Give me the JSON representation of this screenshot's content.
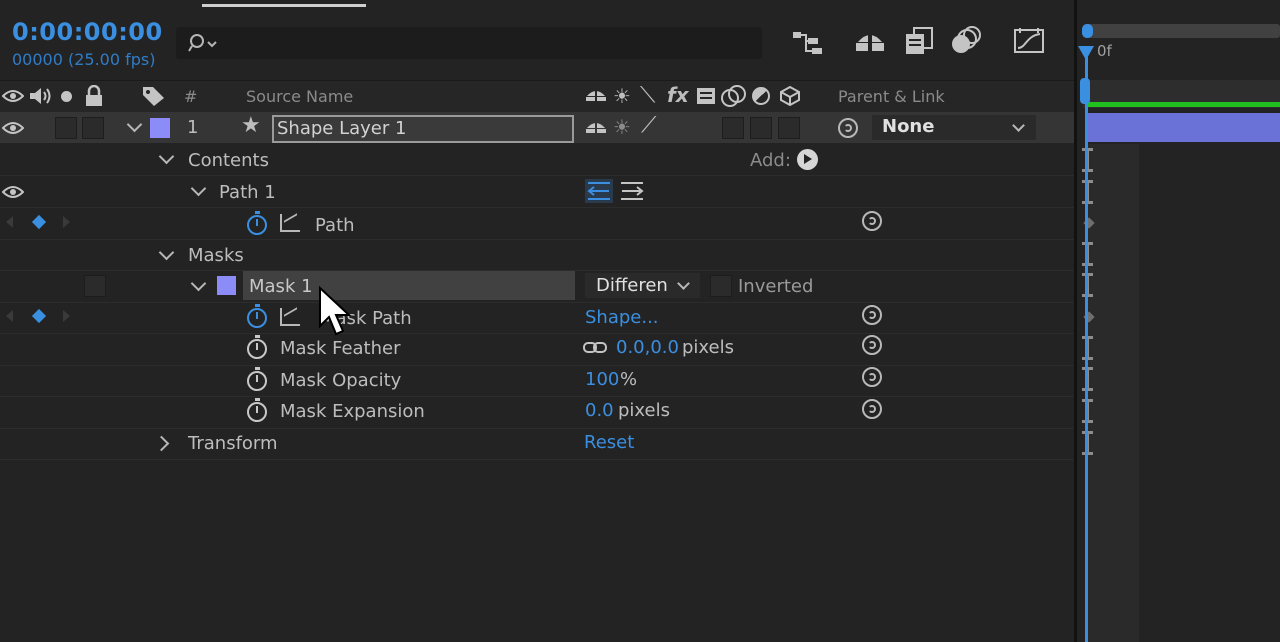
{
  "timecode": {
    "current": "0:00:00:00",
    "frames": "00000 (25.00 fps)"
  },
  "search": {
    "placeholder": ""
  },
  "time_ruler": {
    "label": "0f"
  },
  "columns": {
    "number": "#",
    "source_name": "Source Name",
    "parent_link": "Parent & Link"
  },
  "layer": {
    "index": "1",
    "name": "Shape Layer 1",
    "parent": "None",
    "label_color": "#8b8cf7"
  },
  "contents": {
    "label": "Contents",
    "add_label": "Add:"
  },
  "path_group": {
    "label": "Path 1"
  },
  "path_prop": {
    "label": "Path"
  },
  "masks": {
    "label": "Masks"
  },
  "mask": {
    "name": "Mask 1",
    "mode": "Differen",
    "inverted_label": "Inverted",
    "color": "#8b8cf7"
  },
  "mask_path": {
    "label": "Mask Path",
    "value": "Shape..."
  },
  "mask_feather": {
    "label": "Mask Feather",
    "value": "0.0,0.0",
    "unit": "pixels"
  },
  "mask_opacity": {
    "label": "Mask Opacity",
    "value": "100",
    "unit": "%"
  },
  "mask_expansion": {
    "label": "Mask Expansion",
    "value": "0.0",
    "unit": "pixels"
  },
  "transform": {
    "label": "Transform",
    "value": "Reset"
  },
  "colors": {
    "accent_blue": "#3b8fe0",
    "layer_bar": "#6a72d8",
    "work_area": "#20c020"
  }
}
